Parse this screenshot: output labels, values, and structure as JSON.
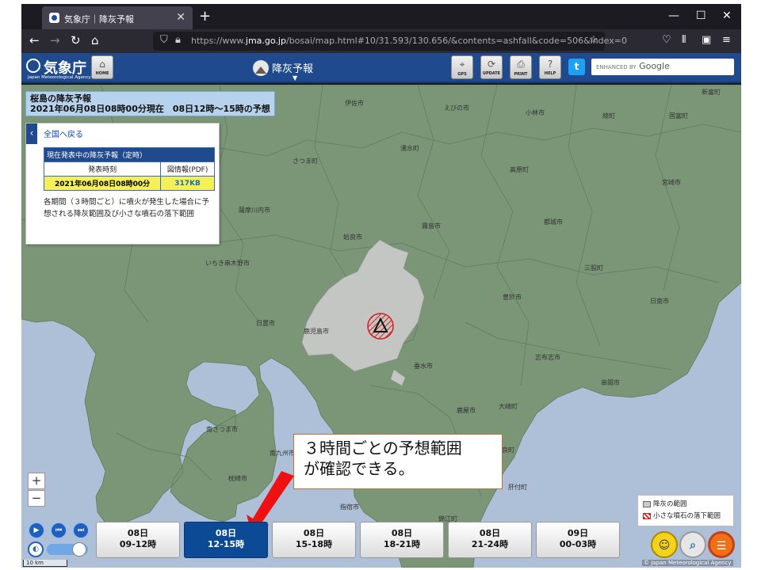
{
  "browser": {
    "tab_title": "気象庁｜降灰予報",
    "tab_close": "✕",
    "newtab": "+",
    "url_prefix": "https://www.",
    "url_domain": "jma.go.jp",
    "url_rest": "/bosai/map.html#10/31.593/130.656/&contents=ashfall&code=506&index=0"
  },
  "header": {
    "agency_name": "気象庁",
    "agency_en": "Japan Meteorological Agency",
    "home_label": "HOME",
    "product_title": "降灰予報",
    "gps_label": "GPS",
    "update_label": "UPDATE",
    "print_label": "PRINT",
    "help_label": "HELP",
    "search_enhanced": "ENHANCED BY",
    "search_brand": "Google"
  },
  "map": {
    "title_line1": "桜島の降灰予報",
    "title_line2": "2021年06月08日08時00分現在　08日12時～15時の予想",
    "places": [
      {
        "name": "伊佐市"
      },
      {
        "name": "えびの市"
      },
      {
        "name": "新富町"
      },
      {
        "name": "小林市"
      },
      {
        "name": "綾町"
      },
      {
        "name": "国富町"
      },
      {
        "name": "さつま町"
      },
      {
        "name": "湧水町"
      },
      {
        "name": "高原町"
      },
      {
        "name": "宮崎市"
      },
      {
        "name": "薩摩川内市"
      },
      {
        "name": "霧島市"
      },
      {
        "name": "都城市"
      },
      {
        "name": "姶良市"
      },
      {
        "name": "いちき串木野市"
      },
      {
        "name": "三股町"
      },
      {
        "name": "曽於市"
      },
      {
        "name": "日置市"
      },
      {
        "name": "日南市"
      },
      {
        "name": "鹿児島市"
      },
      {
        "name": "垂水市"
      },
      {
        "name": "志布志市"
      },
      {
        "name": "串間市"
      },
      {
        "name": "大崎町"
      },
      {
        "name": "鹿屋市"
      },
      {
        "name": "南さつま市"
      },
      {
        "name": "南九州市"
      },
      {
        "name": "東串良町"
      },
      {
        "name": "枕崎市"
      },
      {
        "name": "肝付町"
      },
      {
        "name": "指宿市"
      },
      {
        "name": "錦江町"
      }
    ],
    "zoom_in": "+",
    "zoom_out": "−",
    "scale": "10 km",
    "copyright": "© Japan Meteorological Agency"
  },
  "panel": {
    "back_label": "全国へ戻る",
    "table_header": "現在発表中の降灰予報（定時）",
    "col_time": "発表時刻",
    "col_pdf": "図情報(PDF)",
    "issue_time": "2021年06月08日08時00分",
    "pdf_size": "317KB",
    "note": "各期間（３時間ごと）に噴火が発生した場合に予想される降灰範囲及び小さな噴石の落下範囲"
  },
  "callout": {
    "line1": "３時間ごとの予想範囲",
    "line2": "が確認できる。"
  },
  "legend": {
    "ash_label": "降灰の範囲",
    "stone_label": "小さな噴石の落下範囲"
  },
  "timeline": {
    "selected_index": 1,
    "slots": [
      {
        "day": "08日",
        "range": "09-12時"
      },
      {
        "day": "08日",
        "range": "12-15時"
      },
      {
        "day": "08日",
        "range": "15-18時"
      },
      {
        "day": "08日",
        "range": "18-21時"
      },
      {
        "day": "08日",
        "range": "21-24時"
      },
      {
        "day": "09日",
        "range": "00-03時"
      }
    ]
  },
  "colors": {
    "jma_blue": "#1f4a8e",
    "land": "#7a9677",
    "sea": "#aebfd8",
    "ash": "#c9c9c9",
    "stone_hatch": "#d62020",
    "active_slot": "#0d4a96",
    "arrow": "#ee1111"
  }
}
